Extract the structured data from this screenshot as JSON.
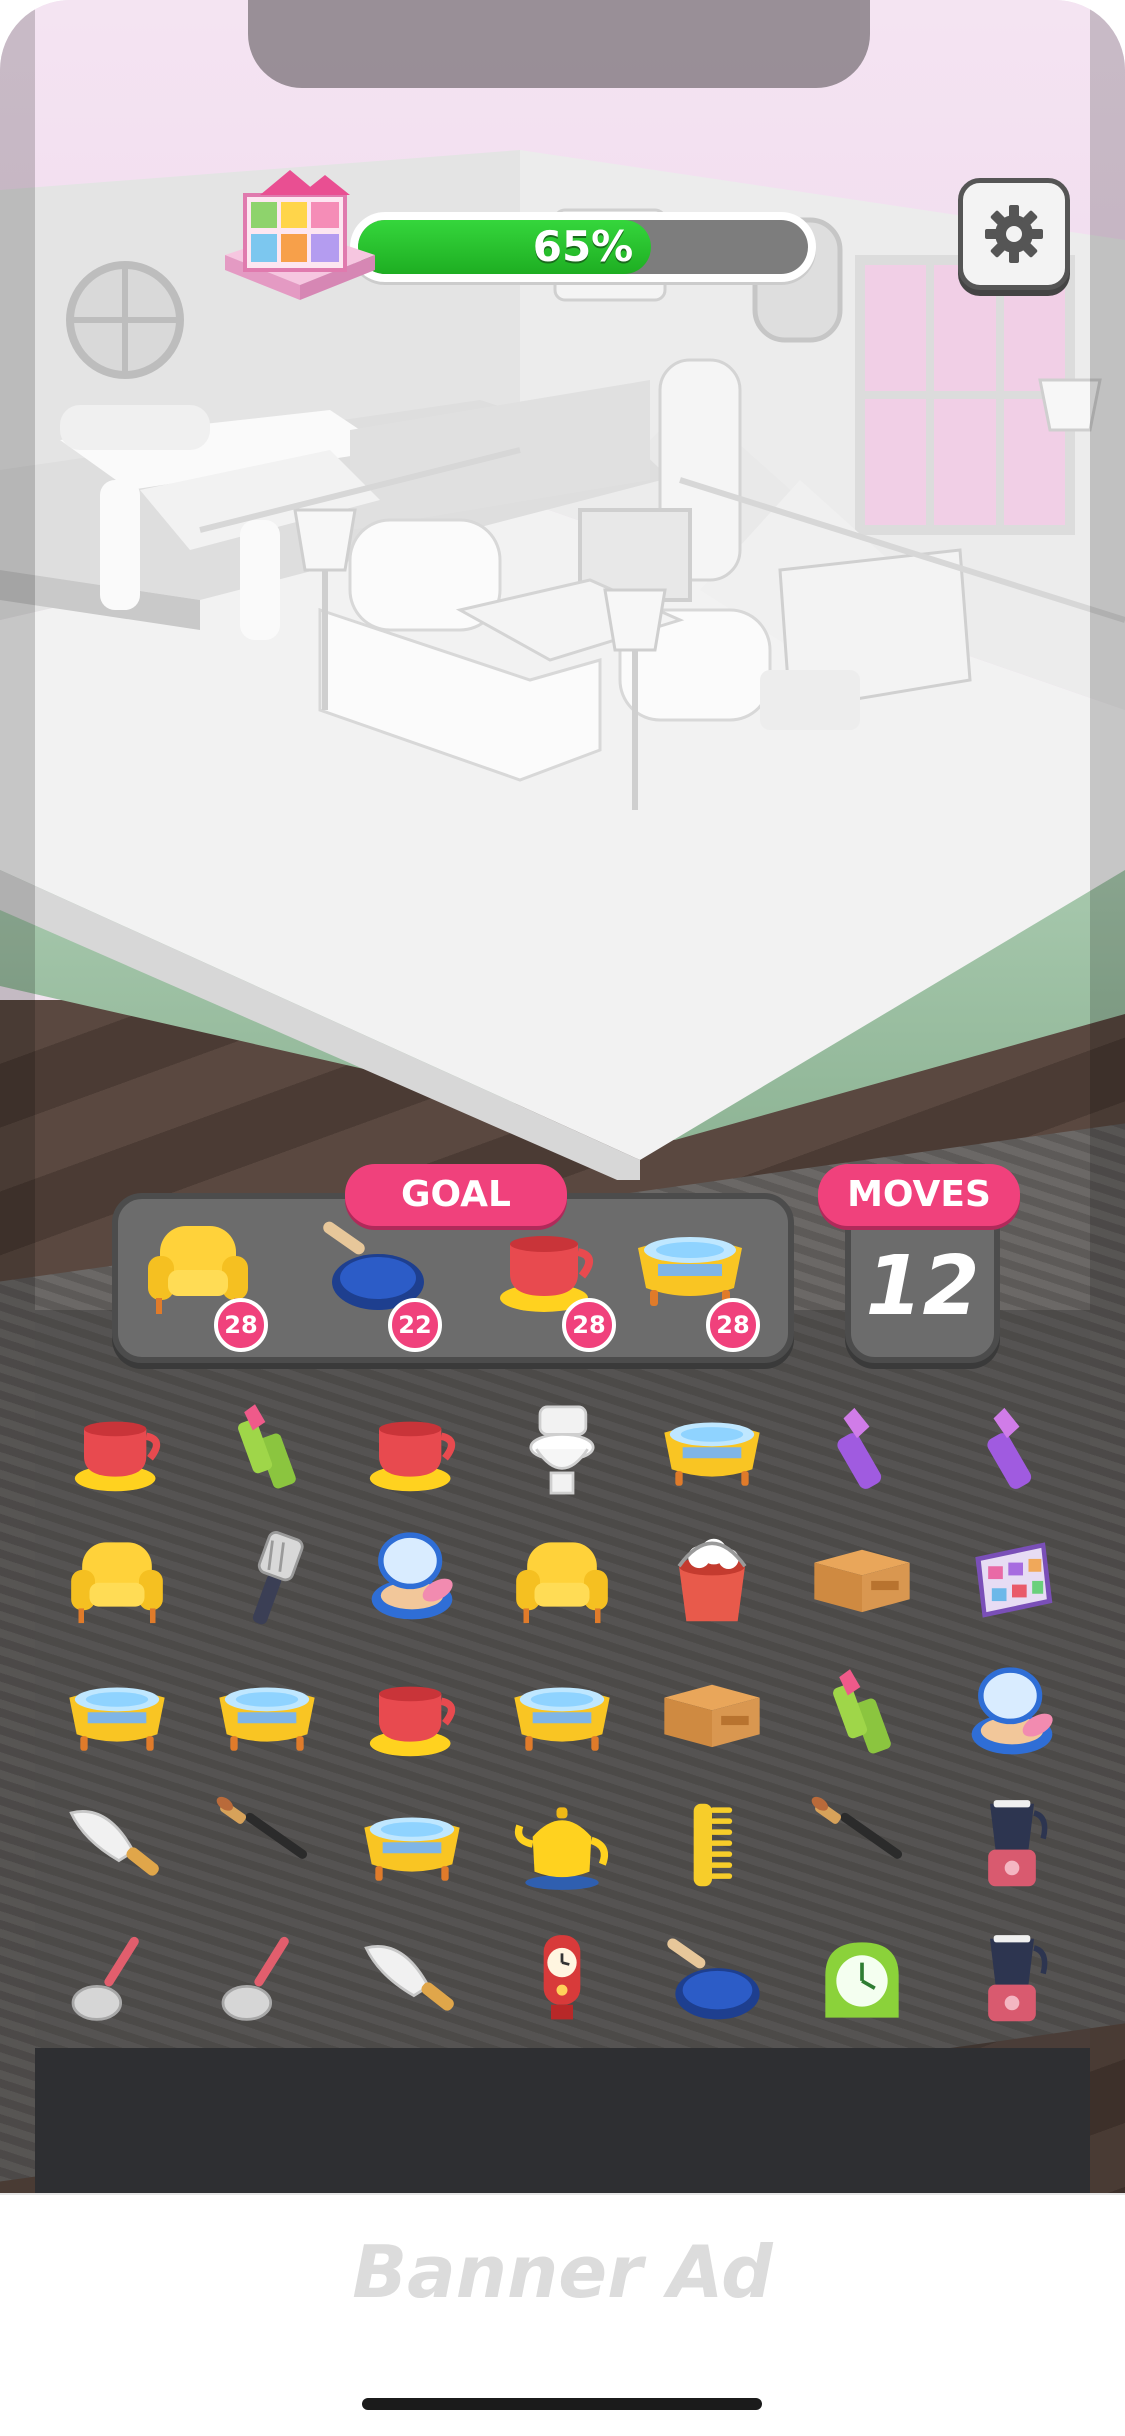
{
  "hud": {
    "progress_text": "65%",
    "progress_value": 0.65,
    "progress_color": "#22b626",
    "level_icon": "dollhouse-icon",
    "settings_icon": "gear-icon"
  },
  "goal": {
    "label": "GOAL",
    "items": [
      {
        "icon": "armchair-icon",
        "count": "28"
      },
      {
        "icon": "frying-pan-icon",
        "count": "22"
      },
      {
        "icon": "teacup-icon",
        "count": "28"
      },
      {
        "icon": "bathtub-icon",
        "count": "28"
      }
    ]
  },
  "moves": {
    "label": "MOVES",
    "value": "12"
  },
  "board": {
    "rows": [
      [
        "teacup-icon",
        "lipstick-icon",
        "teacup-icon",
        "toilet-icon",
        "bathtub-icon",
        "purple-lipstick-icon",
        "purple-lipstick-icon"
      ],
      [
        "armchair-icon",
        "spatula-icon",
        "compact-powder-icon",
        "armchair-icon",
        "bucket-icon",
        "desk-icon",
        "eyeshadow-palette-icon"
      ],
      [
        "bathtub-icon",
        "bathtub-icon",
        "teacup-icon",
        "bathtub-icon",
        "desk-icon",
        "lipstick-icon",
        "compact-powder-icon"
      ],
      [
        "kitchen-knife-icon",
        "makeup-brush-icon",
        "bathtub-icon",
        "teapot-icon",
        "comb-icon",
        "makeup-brush-icon",
        "blender-icon"
      ],
      [
        "ladle-icon",
        "ladle-icon",
        "kitchen-knife-icon",
        "clock-icon",
        "frying-pan-icon",
        "alarm-clock-icon",
        "blender-icon"
      ]
    ]
  },
  "banner": {
    "text": "Banner Ad"
  }
}
